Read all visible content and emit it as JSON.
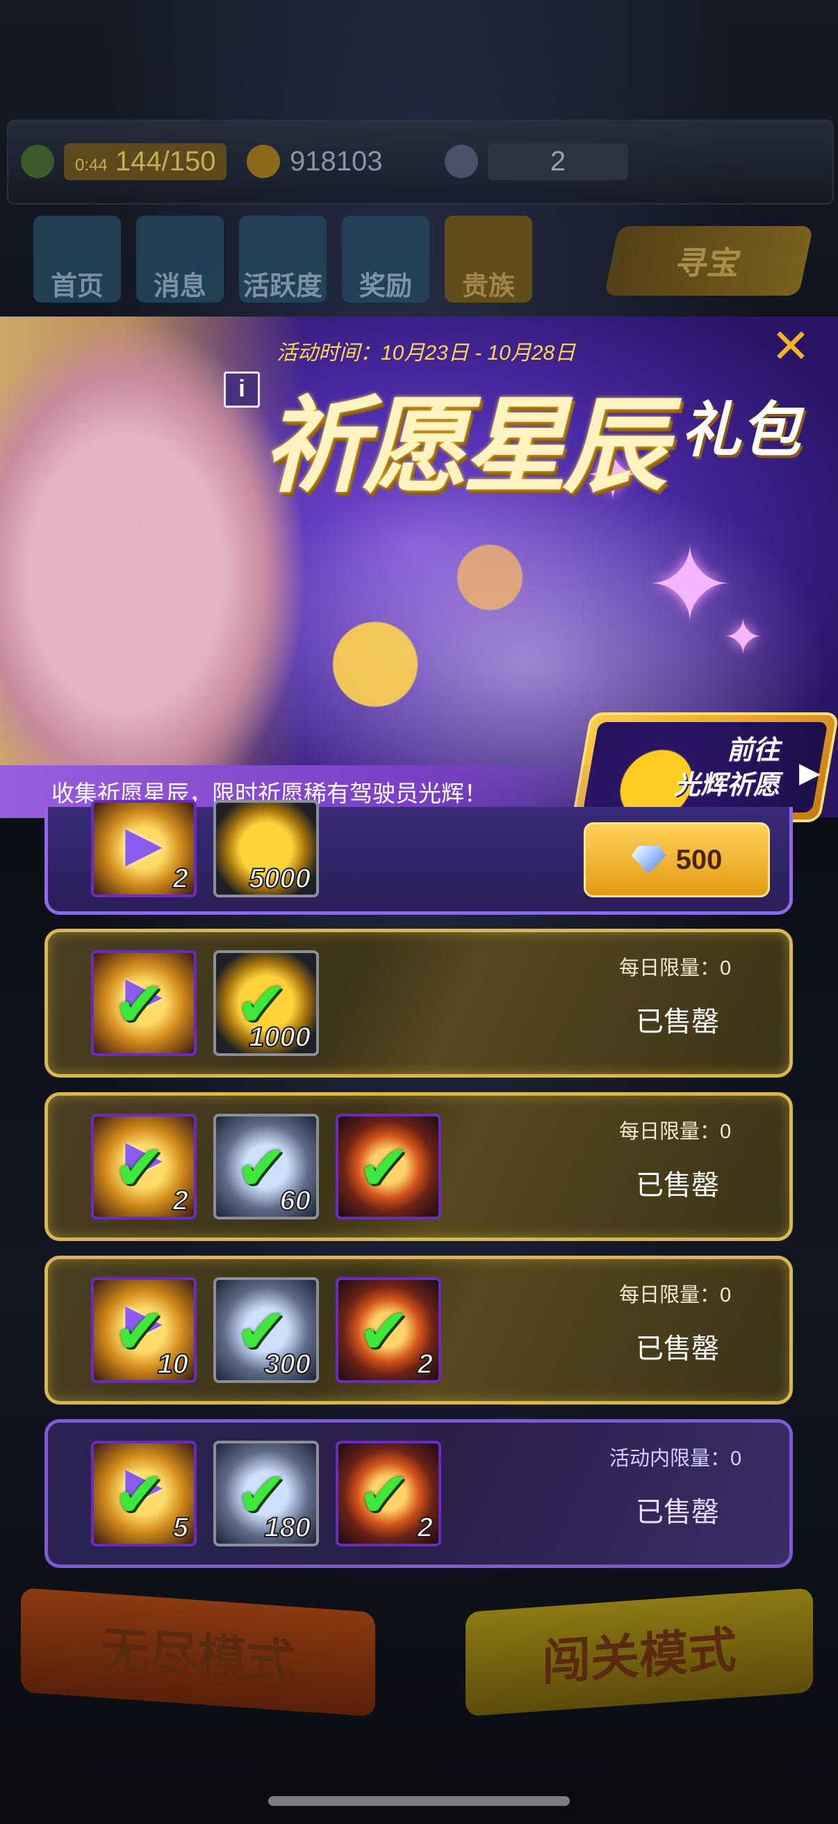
{
  "resources": {
    "energy_timer": "0:44",
    "energy": "144/150",
    "coins": "918103",
    "gems": "2"
  },
  "nav_tabs": [
    "首页",
    "消息",
    "活跃度",
    "奖励",
    "贵族"
  ],
  "treasure_label": "寻宝",
  "event": {
    "time": "活动时间：10月23日 - 10月28日",
    "title": "祈愿星辰",
    "title_suffix": "礼包",
    "info_label": "i",
    "close_label": "✕",
    "goto_label_line1": "前往",
    "goto_label_line2": "光辉祈愿",
    "tagline": "收集祈愿星辰，限时祈愿稀有驾驶员光辉！"
  },
  "packs": [
    {
      "items": [
        {
          "icon": "wish-star-icon",
          "qty": "2"
        },
        {
          "icon": "gold-coin-icon",
          "qty": "5000"
        }
      ],
      "price": "500",
      "price_currency": "diamond-icon"
    },
    {
      "limit": "每日限量：0",
      "status": "已售罄",
      "items": [
        {
          "icon": "wish-star-icon",
          "qty": ""
        },
        {
          "icon": "gold-coin-icon",
          "qty": "1000"
        }
      ]
    },
    {
      "limit": "每日限量：0",
      "status": "已售罄",
      "items": [
        {
          "icon": "wish-star-icon",
          "qty": "2"
        },
        {
          "icon": "diamond-icon",
          "qty": "60"
        },
        {
          "icon": "fragment-icon",
          "qty": ""
        }
      ]
    },
    {
      "limit": "每日限量：0",
      "status": "已售罄",
      "items": [
        {
          "icon": "wish-star-icon",
          "qty": "10"
        },
        {
          "icon": "diamond-icon",
          "qty": "300"
        },
        {
          "icon": "fragment-icon",
          "qty": "2"
        }
      ]
    },
    {
      "limit": "活动内限量：0",
      "status": "已售罄",
      "items": [
        {
          "icon": "wish-star-icon",
          "qty": "5"
        },
        {
          "icon": "diamond-icon",
          "qty": "180"
        },
        {
          "icon": "fragment-icon",
          "qty": "2"
        }
      ]
    }
  ],
  "modes": {
    "endless": "无尽模式",
    "stage": "闯关模式"
  },
  "colors": {
    "accent_gold": "#d9b64f",
    "accent_purple": "#7d5ad6",
    "check_green": "#3ee83a",
    "close_orange": "#f2b52a"
  }
}
